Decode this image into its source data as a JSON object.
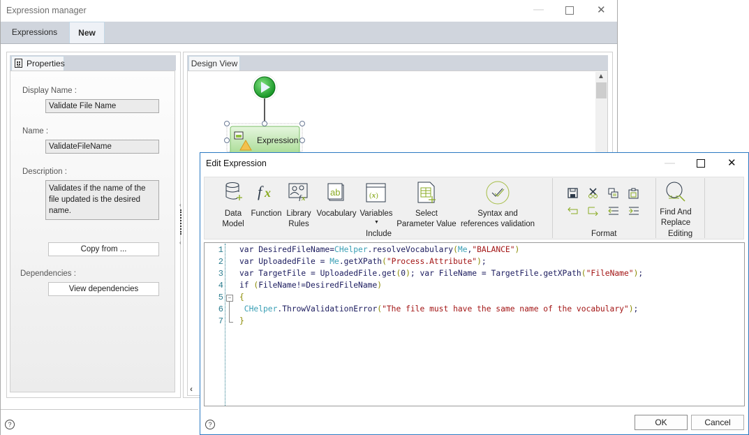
{
  "manager": {
    "title": "Expression manager",
    "tabs": [
      {
        "label": "Expressions"
      },
      {
        "label": "New"
      }
    ],
    "active_tab": "New",
    "properties": {
      "tab_label": "Properties",
      "display_name_label": "Display Name :",
      "display_name_value": "Validate File Name",
      "name_label": "Name :",
      "name_value": "ValidateFileName",
      "description_label": "Description :",
      "description_value": "Validates if the name of the file updated is the desired name.",
      "copy_from_label": "Copy from ...",
      "dependencies_label": "Dependencies :",
      "view_dependencies_label": "View dependencies"
    },
    "design": {
      "tab_label": "Design View",
      "node_label": "Expression"
    }
  },
  "edit_dialog": {
    "title": "Edit Expression",
    "ribbon": {
      "include": [
        {
          "label": "Data Model",
          "icon": "database-add-icon"
        },
        {
          "label": "Function",
          "icon": "function-fx-icon"
        },
        {
          "label": "Library Rules",
          "icon": "library-rules-icon"
        },
        {
          "label": "Vocabulary",
          "icon": "vocabulary-icon"
        },
        {
          "label": "Variables",
          "icon": "variables-icon"
        },
        {
          "label": "Select Parameter Value",
          "icon": "parameter-table-icon"
        },
        {
          "label": "Syntax and references validation",
          "icon": "validation-check-icon"
        }
      ],
      "include_group": "Include",
      "format_group": "Format",
      "format_tools": [
        "save-icon",
        "cut-icon",
        "copy-icon",
        "paste-icon",
        "undo-icon",
        "redo-icon",
        "outdent-icon",
        "indent-icon"
      ],
      "editing": {
        "label": "Find And Replace",
        "icon": "find-replace-icon"
      },
      "editing_group": "Editing"
    },
    "code_lines": [
      {
        "n": "1",
        "tokens": [
          [
            "kw",
            "var DesiredFileName="
          ],
          [
            "tk-obj",
            "CHelper"
          ],
          [
            "tk-plain",
            ".resolveVocabulary"
          ],
          [
            "tk-br",
            "("
          ],
          [
            "tk-obj",
            "Me"
          ],
          [
            "tk-plain",
            ","
          ],
          [
            "tk-str",
            "\"BALANCE\""
          ],
          [
            "tk-br",
            ")"
          ]
        ]
      },
      {
        "n": "2",
        "tokens": [
          [
            "kw",
            "var UploadedFile = "
          ],
          [
            "tk-obj",
            "Me"
          ],
          [
            "tk-plain",
            ".getXPath"
          ],
          [
            "tk-br",
            "("
          ],
          [
            "tk-str",
            "\"Process.Attribute\""
          ],
          [
            "tk-br",
            ")"
          ],
          [
            "tk-plain",
            ";"
          ]
        ]
      },
      {
        "n": "3",
        "tokens": [
          [
            "kw",
            "var TargetFile = UploadedFile.get"
          ],
          [
            "tk-br",
            "("
          ],
          [
            "tk-plain",
            "0"
          ],
          [
            "tk-br",
            ")"
          ],
          [
            "tk-plain",
            "; var FileName = TargetFile.getXPath"
          ],
          [
            "tk-br",
            "("
          ],
          [
            "tk-str",
            "\"FileName\""
          ],
          [
            "tk-br",
            ")"
          ],
          [
            "tk-plain",
            ";"
          ]
        ]
      },
      {
        "n": "4",
        "tokens": [
          [
            "kw",
            "if "
          ],
          [
            "tk-br",
            "("
          ],
          [
            "tk-plain",
            "FileName!=DesiredFileName"
          ],
          [
            "tk-br",
            ")"
          ]
        ]
      },
      {
        "n": "5",
        "tokens": [
          [
            "tk-br",
            "{"
          ]
        ]
      },
      {
        "n": "6",
        "tokens": [
          [
            "tk-obj",
            " CHelper"
          ],
          [
            "tk-plain",
            ".ThrowValidationError"
          ],
          [
            "tk-br",
            "("
          ],
          [
            "tk-str",
            "\"The file must have the same name of the vocabulary\""
          ],
          [
            "tk-br",
            ")"
          ],
          [
            "tk-plain",
            ";"
          ]
        ]
      },
      {
        "n": "7",
        "tokens": [
          [
            "tk-br",
            "}"
          ]
        ]
      }
    ],
    "ok_label": "OK",
    "cancel_label": "Cancel"
  }
}
